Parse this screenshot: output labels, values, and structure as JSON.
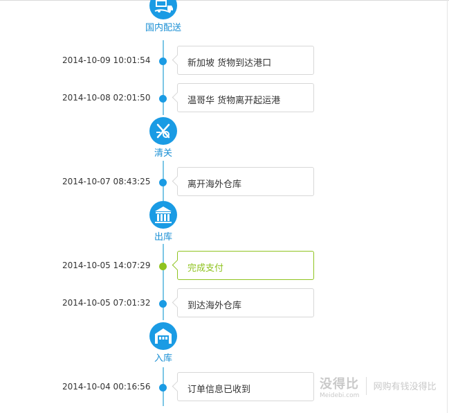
{
  "stages": [
    {
      "label": "国内配送",
      "icon": "domestic-delivery-icon"
    },
    {
      "label": "清关",
      "icon": "customs-clearance-icon"
    },
    {
      "label": "出库",
      "icon": "warehouse-out-icon"
    },
    {
      "label": "入库",
      "icon": "warehouse-in-icon"
    }
  ],
  "events": [
    {
      "time": "2014-10-09 10:01:54",
      "message": "新加坡 货物到达港口",
      "highlight": false
    },
    {
      "time": "2014-10-08 02:01:50",
      "message": "温哥华 货物离开起运港",
      "highlight": false
    },
    {
      "time": "2014-10-07 08:43:25",
      "message": "离开海外仓库",
      "highlight": false
    },
    {
      "time": "2014-10-05 14:07:29",
      "message": "完成支付",
      "highlight": true
    },
    {
      "time": "2014-10-05 07:01:32",
      "message": "到达海外仓库",
      "highlight": false
    },
    {
      "time": "2014-10-04 00:16:56",
      "message": "订单信息已收到",
      "highlight": false
    }
  ],
  "watermark": {
    "brand": "没得比",
    "slogan": "网购有钱没得比",
    "domain": "Meidebi.com"
  },
  "colors": {
    "accent": "#1a9be4",
    "line": "#7cc6e6",
    "highlight": "#8fc31f",
    "border": "#d7d7d7"
  }
}
